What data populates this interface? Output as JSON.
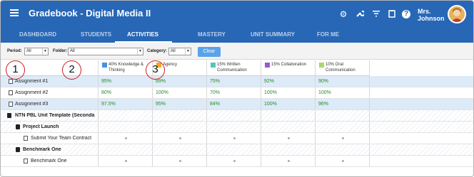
{
  "topbar": {
    "title": "Gradebook - Digital Media II",
    "user_name_line1": "Mrs.",
    "user_name_line2": "Johnson"
  },
  "tabs": [
    {
      "label": "DASHBOARD"
    },
    {
      "label": "STUDENTS"
    },
    {
      "label": "ACTIVITIES"
    },
    {
      "label": "MASTERY"
    },
    {
      "label": "UNIT SUMMARY"
    },
    {
      "label": "FOR ME"
    }
  ],
  "filters": {
    "period_label": "Period:",
    "period_value": "All",
    "folder_label": "Folder:",
    "folder_value": "All",
    "category_label": "Category:",
    "category_value": "All",
    "clear_label": "Clear"
  },
  "columns": [
    {
      "label": "40% Knowledge & Thinking",
      "color": "#4a90e2"
    },
    {
      "label": "Agency",
      "color": "#f5a623"
    },
    {
      "label": "15% Written Communication",
      "color": "#50c8b4"
    },
    {
      "label": "15% Collaboration",
      "color": "#9b59d0"
    },
    {
      "label": "10% Oral Communication",
      "color": "#a6d96a"
    }
  ],
  "rows": [
    {
      "label": "Assignment #1",
      "values": [
        "95%",
        "89%",
        "75%",
        "92%",
        "90%"
      ]
    },
    {
      "label": "Assignment #2",
      "values": [
        "80%",
        "100%",
        "70%",
        "100%",
        "100%"
      ]
    },
    {
      "label": "Assignment #3",
      "values": [
        "97.5%",
        "95%",
        "84%",
        "100%",
        "96%"
      ]
    },
    {
      "label": "NTN PBL Unit Template (Seconda"
    },
    {
      "label": "Project Launch"
    },
    {
      "label": "Submit Your Team Contract"
    },
    {
      "label": "Benchmark One"
    },
    {
      "label": "Benchmark One"
    }
  ],
  "callouts": [
    "1",
    "2",
    "3"
  ]
}
